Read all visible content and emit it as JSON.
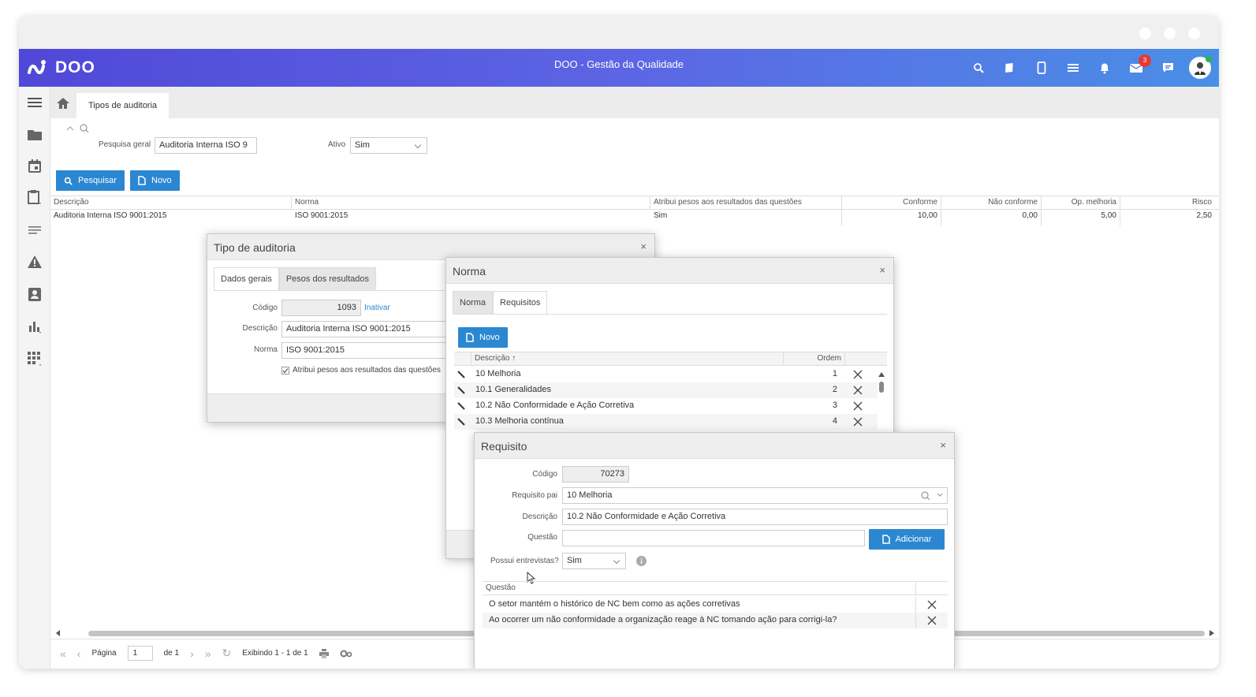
{
  "app": {
    "logo": "DOO",
    "title": "DOO - Gestão da Qualidade",
    "notifications_badge": "3"
  },
  "topbar_icons": [
    "search-icon",
    "book-icon",
    "mobile-icon",
    "list-icon",
    "bell-icon",
    "mail-icon",
    "chat-icon"
  ],
  "sidebar_icons": [
    "menu-icon",
    "folder-icon",
    "calendar-icon",
    "clipboard-icon",
    "lines-icon",
    "warning-icon",
    "contact-icon",
    "chart-icon",
    "apps-icon"
  ],
  "page": {
    "tab": "Tipos de auditoria"
  },
  "filters": {
    "search_label": "Pesquisa geral",
    "search_value": "Auditoria Interna ISO 9",
    "ativo_label": "Ativo",
    "ativo_value": "Sim"
  },
  "buttons": {
    "search": "Pesquisar",
    "new": "Novo"
  },
  "main_grid": {
    "headers": [
      "Descrição",
      "Norma",
      "Atribui pesos aos resultados das questões",
      "Conforme",
      "Não conforme",
      "Op. melhoria",
      "Risco"
    ],
    "rows": [
      [
        "Auditoria Interna ISO 9001:2015",
        "ISO 9001:2015",
        "Sim",
        "10,00",
        "0,00",
        "5,00",
        "2,50"
      ]
    ]
  },
  "pager": {
    "page_label": "Página",
    "page_value": "1",
    "of_label": "de 1",
    "showing": "Exibindo 1 - 1 de 1"
  },
  "dlg_tipo": {
    "title": "Tipo de auditoria",
    "close": "×",
    "tabs": [
      "Dados gerais",
      "Pesos dos resultados"
    ],
    "codigo_label": "Código",
    "codigo_value": "1093",
    "inativar": "Inativar",
    "descricao_label": "Descrição",
    "descricao_value": "Auditoria Interna ISO 9001:2015",
    "norma_label": "Norma",
    "norma_value": "ISO 9001:2015",
    "checkbox_label": "Atribui pesos aos resultados das questões"
  },
  "dlg_norma": {
    "title": "Norma",
    "close": "×",
    "tabs": [
      "Norma",
      "Requisitos"
    ],
    "new_button": "Novo",
    "headers": [
      "Descrição",
      "Ordem"
    ],
    "rows": [
      {
        "desc": "10 Melhoria",
        "ordem": "1"
      },
      {
        "desc": "10.1 Generalidades",
        "ordem": "2"
      },
      {
        "desc": "10.2 Não Conformidade e Ação Corretiva",
        "ordem": "3"
      },
      {
        "desc": "10.3 Melhoria contínua",
        "ordem": "4"
      }
    ]
  },
  "dlg_req": {
    "title": "Requisito",
    "close": "×",
    "codigo_label": "Código",
    "codigo_value": "70273",
    "pai_label": "Requisito pai",
    "pai_value": "10 Melhoria",
    "descricao_label": "Descrição",
    "descricao_value": "10.2 Não Conformidade e Ação Corretiva",
    "questao_label": "Questão",
    "questao_value": "",
    "add_button": "Adicionar",
    "entrevistas_label": "Possui entrevistas?",
    "entrevistas_value": "Sim",
    "grid_header": "Questão",
    "questions": [
      "O setor mantém o histórico de NC bem como as ações corretivas",
      "Ao ocorrer um não conformidade a organização reage à NC tomando ação para corrigi-la?"
    ]
  }
}
